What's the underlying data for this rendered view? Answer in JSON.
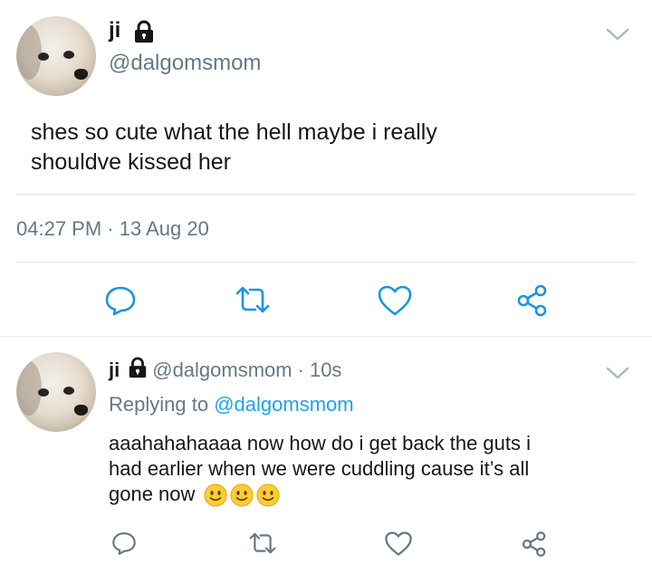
{
  "main_tweet": {
    "author_name": "ji",
    "author_handle": "@dalgomsmom",
    "text_line1": "shes so cute what the hell maybe i really",
    "text_line2": "shouldve kissed her",
    "timestamp": "04:27 PM · 13 Aug 20"
  },
  "reply_tweet": {
    "author_name": "ji",
    "author_handle": "@dalgomsmom",
    "time_sep": "·",
    "time_ago": "10s",
    "replying_prefix": "Replying to",
    "replying_handle": "@dalgomsmom",
    "text_line1": "aaahahahaaaa now how do i get back the guts i",
    "text_line2": "had earlier when we were cuddling cause it’s all",
    "text_line3": "gone now",
    "emoji_count": 3
  },
  "icons": {
    "action_icons": [
      "reply-icon",
      "retweet-icon",
      "like-icon",
      "share-icon"
    ],
    "lock": "lock-icon",
    "menu": "chevron-down-icon"
  },
  "colors": {
    "secondary_text": "#657786",
    "link": "#1da1f2",
    "icon": "#1b95e0",
    "divider": "#e1e8ed"
  }
}
